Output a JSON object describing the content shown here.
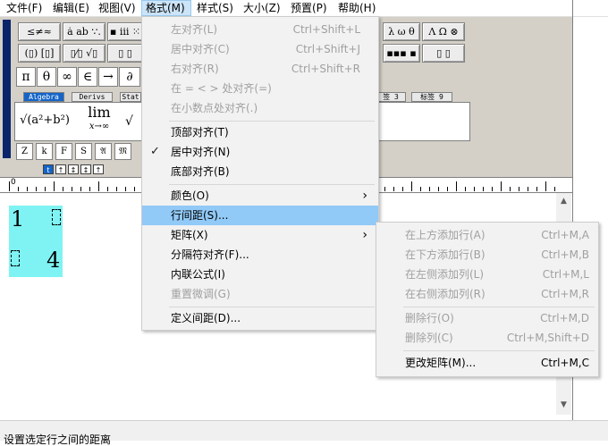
{
  "menubar": {
    "items": [
      {
        "label": "文件(F)"
      },
      {
        "label": "编辑(E)"
      },
      {
        "label": "视图(V)"
      },
      {
        "label": "格式(M)"
      },
      {
        "label": "样式(S)"
      },
      {
        "label": "大小(Z)"
      },
      {
        "label": "预置(P)"
      },
      {
        "label": "帮助(H)"
      }
    ]
  },
  "toolbar": {
    "row1": [
      "≤≠≈",
      "ȧ ab ∵.",
      "▪ ⅲ ⁙",
      "λ ω θ",
      "Λ Ω ⊗"
    ],
    "row2": [
      "(▯) [▯]",
      "▯⁄▯ √▯",
      "▯ ▯",
      "▪▪▪ ▪",
      "▯ ▯"
    ],
    "symbols": [
      "π",
      "θ",
      "∞",
      "∈",
      "→",
      "∂"
    ],
    "tabs": [
      "Algebra",
      "Derivs",
      "Stat",
      "签 3",
      "标签 9"
    ],
    "templates": {
      "sqrt": "√(a²+b²)",
      "lim_top": "lim",
      "lim_bottom": "x→∞"
    },
    "small_row": [
      "Z",
      "k",
      "F",
      "S",
      "𝔄",
      "𝔐"
    ],
    "mini_buttons": [
      "t",
      "↑",
      "↕",
      "↕",
      "↑"
    ]
  },
  "ruler": {
    "zero_label": "0"
  },
  "editor": {
    "matrix": {
      "cell_top_left": "1",
      "cell_bottom_right": "4"
    }
  },
  "status": {
    "text": "设置选定行之间的距离"
  },
  "format_menu": {
    "items": [
      {
        "label": "左对齐(L)",
        "shortcut": "Ctrl+Shift+L",
        "disabled": true
      },
      {
        "label": "居中对齐(C)",
        "shortcut": "Ctrl+Shift+J",
        "disabled": true
      },
      {
        "label": "右对齐(R)",
        "shortcut": "Ctrl+Shift+R",
        "disabled": true
      },
      {
        "label": "在 = < > 处对齐(=)",
        "shortcut": "",
        "disabled": true
      },
      {
        "label": "在小数点处对齐(.)",
        "shortcut": "",
        "disabled": true
      },
      {
        "label": "顶部对齐(T)",
        "shortcut": "",
        "disabled": false
      },
      {
        "label": "居中对齐(N)",
        "shortcut": "",
        "disabled": false,
        "checked": true
      },
      {
        "label": "底部对齐(B)",
        "shortcut": "",
        "disabled": false
      },
      {
        "label": "颜色(O)",
        "shortcut": "",
        "disabled": false,
        "submenu": true
      },
      {
        "label": "行间距(S)...",
        "shortcut": "",
        "disabled": false,
        "highlighted": true
      },
      {
        "label": "矩阵(X)",
        "shortcut": "",
        "disabled": false,
        "submenu": true
      },
      {
        "label": "分隔符对齐(F)...",
        "shortcut": "",
        "disabled": false
      },
      {
        "label": "内联公式(I)",
        "shortcut": "",
        "disabled": false
      },
      {
        "label": "重置微调(G)",
        "shortcut": "",
        "disabled": true
      },
      {
        "label": "定义间距(D)...",
        "shortcut": "",
        "disabled": false
      }
    ]
  },
  "matrix_submenu": {
    "items": [
      {
        "label": "在上方添加行(A)",
        "shortcut": "Ctrl+M,A",
        "disabled": true
      },
      {
        "label": "在下方添加行(B)",
        "shortcut": "Ctrl+M,B",
        "disabled": true
      },
      {
        "label": "在左侧添加列(L)",
        "shortcut": "Ctrl+M,L",
        "disabled": true
      },
      {
        "label": "在右侧添加列(R)",
        "shortcut": "Ctrl+M,R",
        "disabled": true
      },
      {
        "label": "删除行(O)",
        "shortcut": "Ctrl+M,D",
        "disabled": true
      },
      {
        "label": "删除列(C)",
        "shortcut": "Ctrl+M,Shift+D",
        "disabled": true
      },
      {
        "label": "更改矩阵(M)...",
        "shortcut": "Ctrl+M,C",
        "disabled": false
      }
    ]
  },
  "icons": {
    "check": "✓",
    "submenu_arrow": "›",
    "scroll_up": "▲",
    "scroll_down": "▼"
  }
}
